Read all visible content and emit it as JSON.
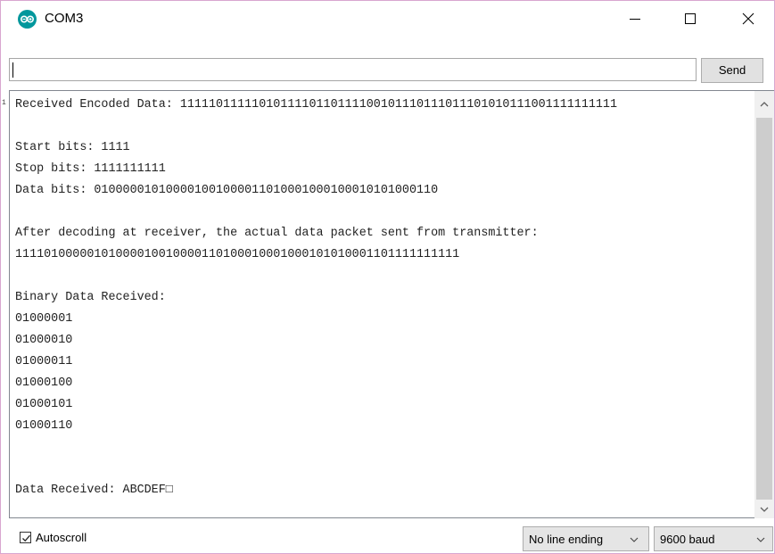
{
  "window": {
    "title": "COM3",
    "app_icon": "arduino-icon",
    "border_color": "#d9a6d0"
  },
  "toolbar": {
    "input_value": "",
    "send_label": "Send"
  },
  "output": {
    "lines": [
      "Received Encoded Data: 1111101111101011110110111100101110111011101010111001111111111",
      "",
      "Start bits: 1111",
      "Stop bits: 1111111111",
      "Data bits: 010000010100001001000011010001000100010101000110",
      "",
      "After decoding at receiver, the actual data packet sent from transmitter:",
      "11110100000101000010010000110100010001000101010001101111111111",
      "",
      "Binary Data Received:",
      "01000001",
      "01000010",
      "01000011",
      "01000100",
      "01000101",
      "01000110",
      "",
      "",
      "Data Received: ABCDEF□"
    ],
    "gutter_mark": "1"
  },
  "status": {
    "autoscroll_label": "Autoscroll",
    "autoscroll_checked": true,
    "line_ending": "No line ending",
    "baud": "9600 baud"
  },
  "colors": {
    "accent": "#00979c",
    "scroll_thumb": "#cdcdcd",
    "button_bg": "#e1e1e1"
  }
}
